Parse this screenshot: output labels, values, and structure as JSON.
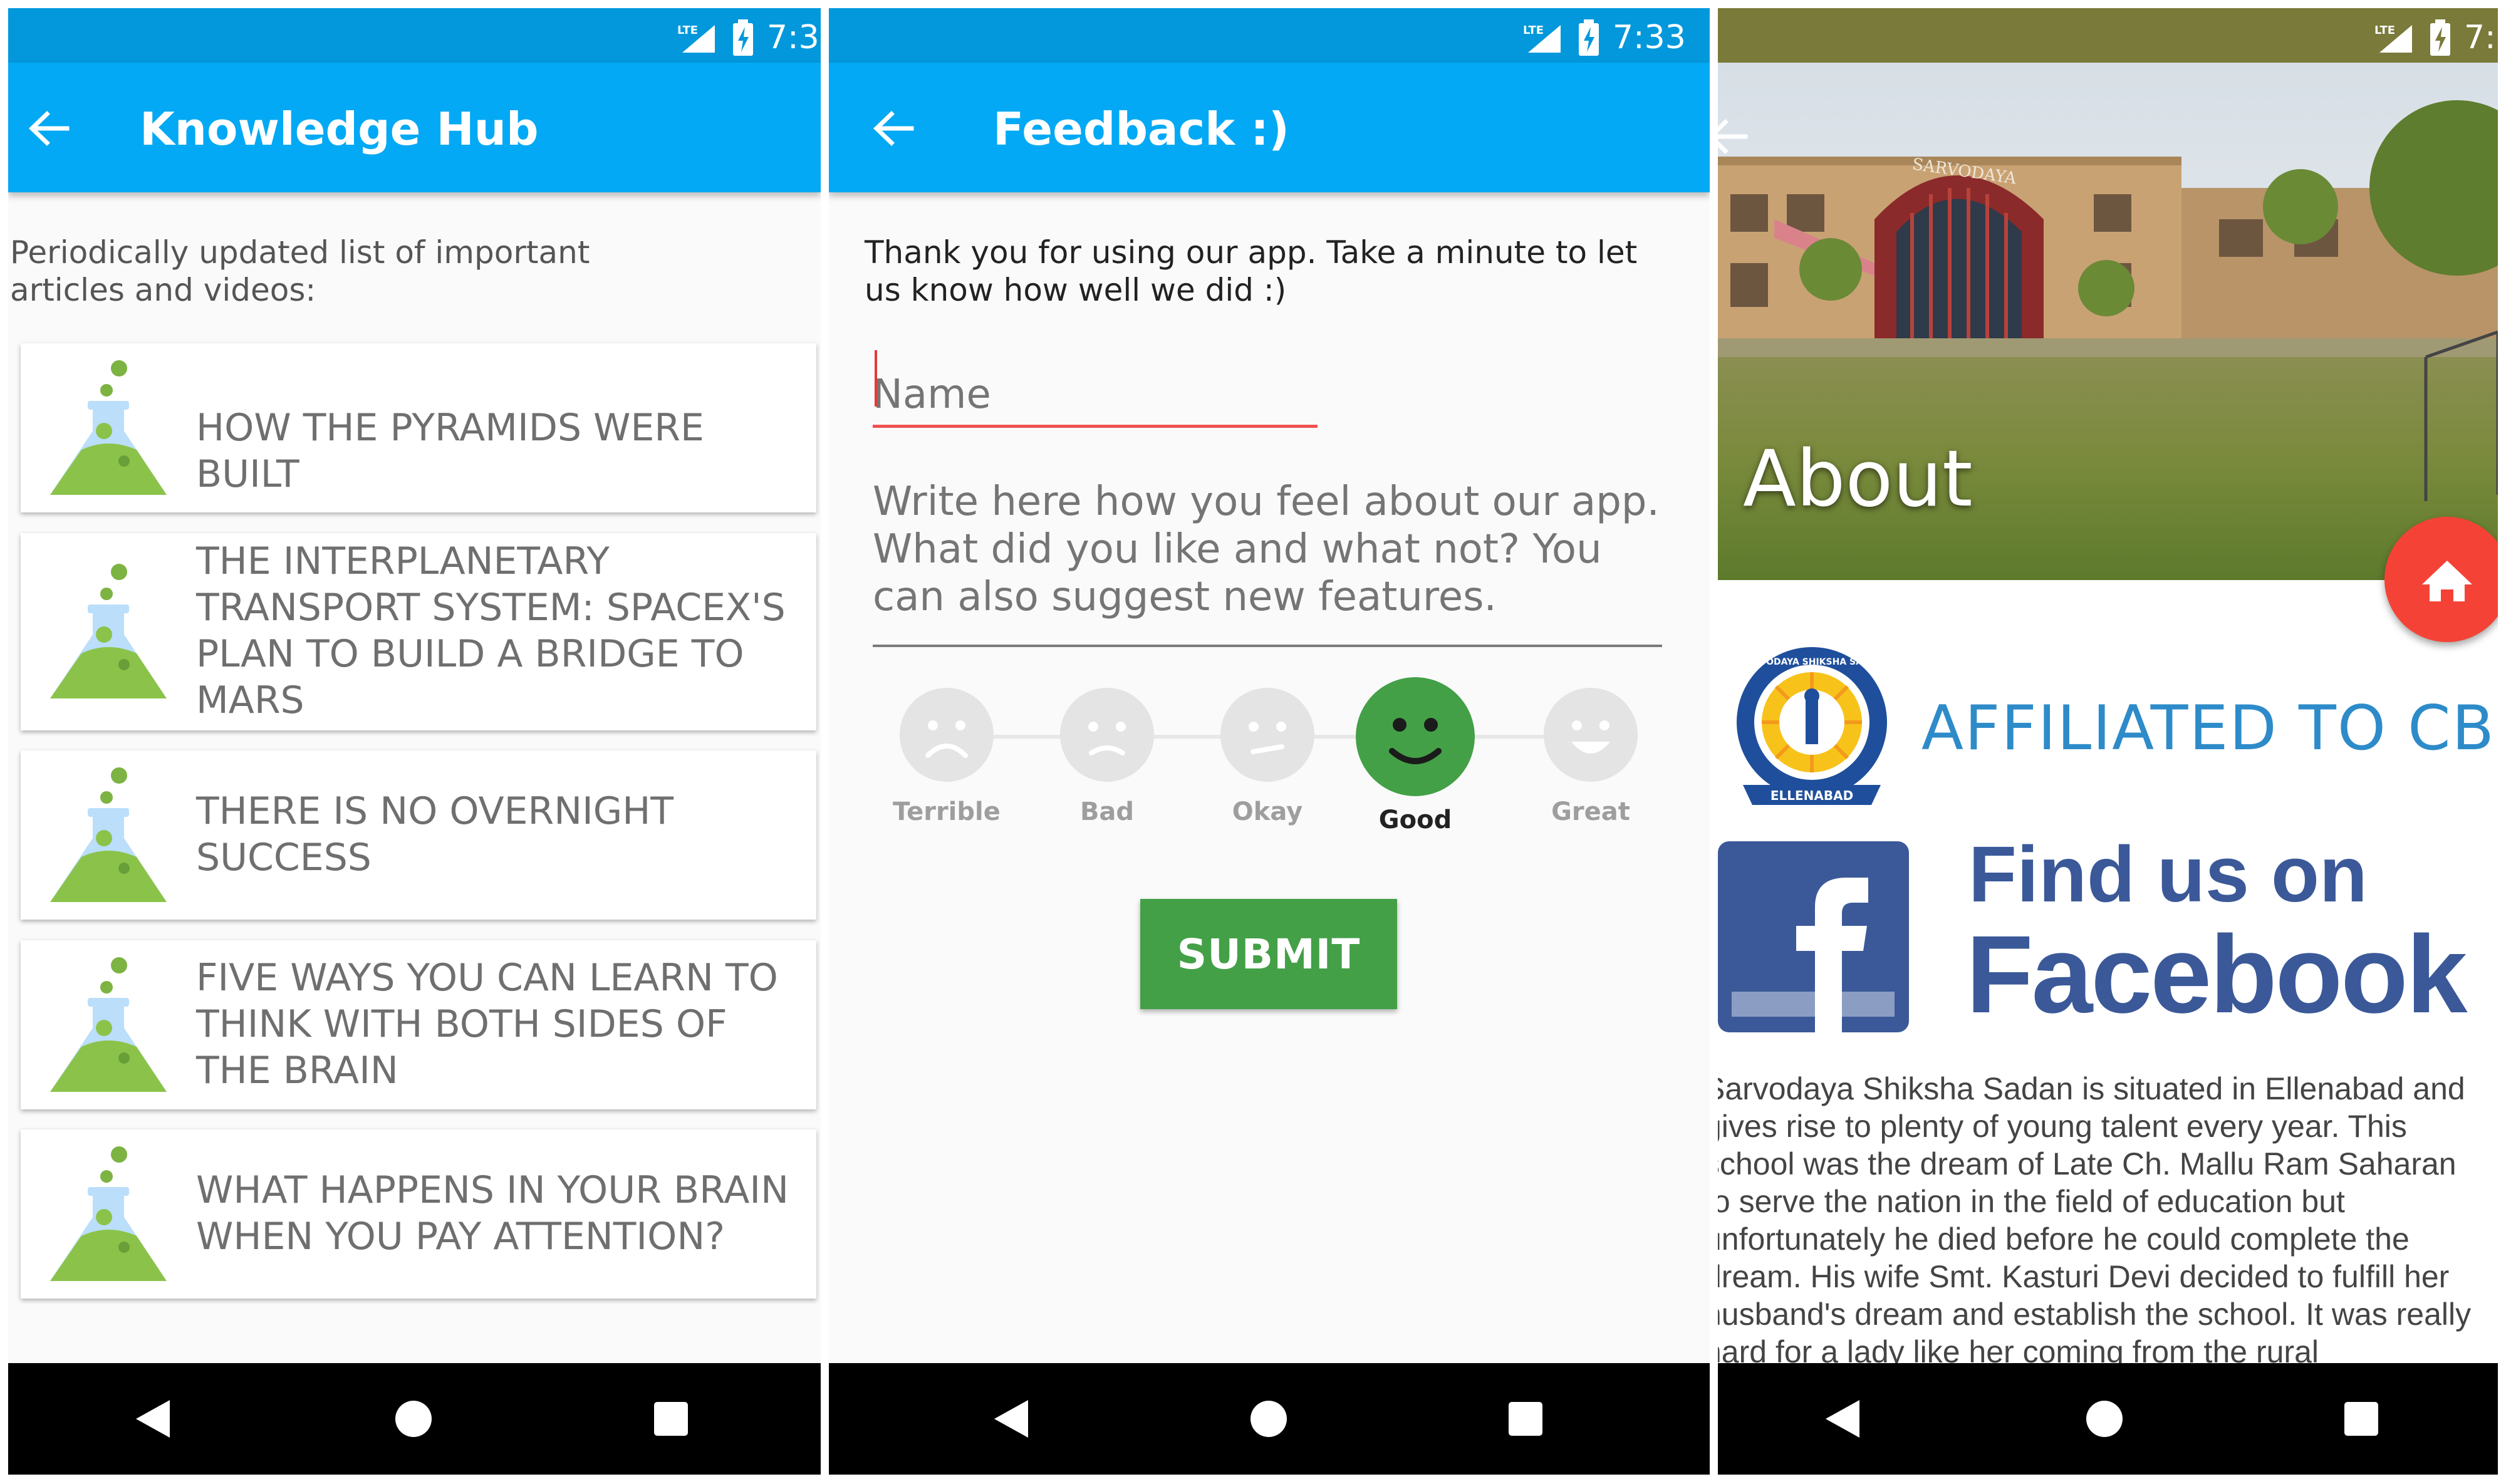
{
  "status": {
    "time": "7:33",
    "network": "LTE"
  },
  "knowledge_hub": {
    "title": "Knowledge Hub",
    "intro": "Periodically updated list of important articles and videos:",
    "articles": [
      {
        "title": "HOW THE PYRAMIDS WERE BUILT"
      },
      {
        "title": "THE INTERPLANETARY TRANSPORT SYSTEM: SPACEX'S PLAN TO BUILD A BRIDGE TO MARS"
      },
      {
        "title": "THERE IS NO OVERNIGHT SUCCESS"
      },
      {
        "title": "FIVE WAYS YOU CAN LEARN TO THINK WITH BOTH SIDES OF THE BRAIN"
      },
      {
        "title": "WHAT HAPPENS IN YOUR BRAIN WHEN YOU PAY ATTENTION?"
      }
    ]
  },
  "feedback": {
    "title": "Feedback :)",
    "intro": "Thank you for using our app. Take a minute to let us know how well we did :)",
    "name_placeholder": "Name",
    "message_placeholder": "Write here how you feel about our app. What did you like and what not? You can also suggest new features.",
    "ratings": [
      "Terrible",
      "Bad",
      "Okay",
      "Good",
      "Great"
    ],
    "selected_rating": "Good",
    "submit_label": "SUBMIT"
  },
  "about": {
    "title": "About",
    "sign_text": "SARVODAYA",
    "logo_text": "SARVODAYA SHIKSHA SADAN",
    "logo_place": "ELLENABAD",
    "affiliation": "AFFILIATED TO CBSE",
    "facebook_line1": "Find us on",
    "facebook_line2": "Facebook",
    "description": "Sarvodaya Shiksha Sadan is situated in Ellenabad and gives rise to plenty of young talent every year. This school was the dream of Late Ch. Mallu Ram Saharan to serve the nation in the field of education but unfortunately he died before he could complete the dream. His wife Smt. Kasturi Devi decided to fulfill her husband's dream and establish the school. It was really hard for a lady like her coming from the rural"
  },
  "colors": {
    "appbar": "#03a9f4",
    "statusbar": "#0398db",
    "submit": "#43a047",
    "fab": "#f44336",
    "facebook": "#3b5998"
  }
}
